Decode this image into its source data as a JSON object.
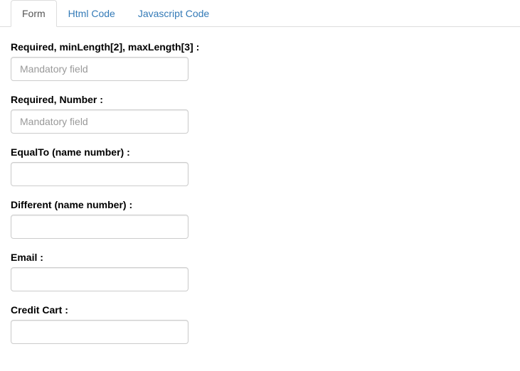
{
  "tabs": [
    {
      "label": "Form",
      "active": true
    },
    {
      "label": "Html Code",
      "active": false
    },
    {
      "label": "Javascript Code",
      "active": false
    }
  ],
  "fields": [
    {
      "label": "Required, minLength[2], maxLength[3] :",
      "placeholder": "Mandatory field",
      "value": ""
    },
    {
      "label": "Required, Number :",
      "placeholder": "Mandatory field",
      "value": ""
    },
    {
      "label": "EqualTo (name number) :",
      "placeholder": "",
      "value": ""
    },
    {
      "label": "Different (name number) :",
      "placeholder": "",
      "value": ""
    },
    {
      "label": "Email :",
      "placeholder": "",
      "value": ""
    },
    {
      "label": "Credit Cart :",
      "placeholder": "",
      "value": ""
    }
  ]
}
